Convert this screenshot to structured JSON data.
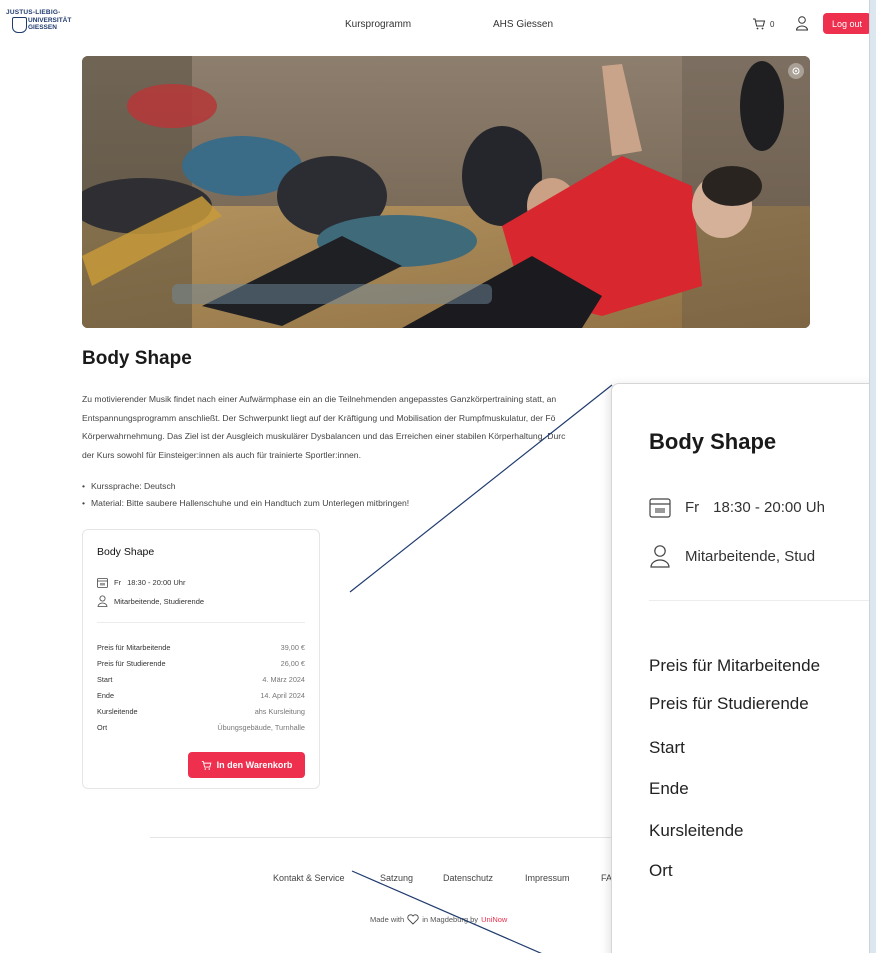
{
  "header": {
    "logo": {
      "line1": "JUSTUS-LIEBIG-",
      "line2": "UNIVERSITÄT",
      "line3": "GIESSEN"
    },
    "nav": [
      {
        "label": "Kursprogramm"
      },
      {
        "label": "AHS Giessen"
      }
    ],
    "cart_count": "0",
    "logout_label": "Log out"
  },
  "course": {
    "title": "Body Shape",
    "description": [
      "Zu motivierender Musik findet nach einer Aufwärmphase ein an die Teilnehmenden angepasstes Ganzkörpertraining statt, an",
      "Entspannungsprogramm anschließt. Der Schwerpunkt liegt auf der Kräftigung und Mobilisation der Rumpfmuskulatur, der Fö",
      "Körperwahrnehmung. Das Ziel ist der Ausgleich muskulärer Dysbalancen und das Erreichen einer stabilen Körperhaltung. Durc",
      "der Kurs sowohl für Einsteiger:innen als auch für trainierte Sportler:innen."
    ],
    "bullets": [
      "Kurssprache: Deutsch",
      "Material: Bitte saubere Hallenschuhe und ein Handtuch zum Unterlegen mitbringen!"
    ]
  },
  "card": {
    "title": "Body Shape",
    "day": "Fr",
    "time": "18:30  - 20:00 Uhr",
    "audience": "Mitarbeitende, Studierende",
    "details": [
      {
        "label": "Preis für Mitarbeitende",
        "value": "39,00 €"
      },
      {
        "label": "Preis für Studierende",
        "value": "26,00 €"
      },
      {
        "label": "Start",
        "value": "4. März 2024"
      },
      {
        "label": "Ende",
        "value": "14. April 2024"
      },
      {
        "label": "Kursleitende",
        "value": "ahs Kursleitung"
      },
      {
        "label": "Ort",
        "value": "Übungsgebäude, Turnhalle"
      }
    ],
    "cart_button": "In den Warenkorb"
  },
  "footer": {
    "links": [
      "Kontakt & Service",
      "Satzung",
      "Datenschutz",
      "Impressum",
      "FA"
    ],
    "made_prefix": "Made with",
    "made_middle": "in Magdeburg by",
    "made_brand": "UniNow"
  },
  "zoom": {
    "title": "Body Shape",
    "day": "Fr",
    "time": "18:30  - 20:00 Uh",
    "audience": "Mitarbeitende, Stud",
    "labels": [
      "Preis für Mitarbeitende",
      "Preis für Studierende",
      "Start",
      "Ende",
      "Kursleitende",
      "Ort"
    ]
  },
  "colors": {
    "accent": "#ef2f4e",
    "annotation": "#1f3b6e"
  }
}
